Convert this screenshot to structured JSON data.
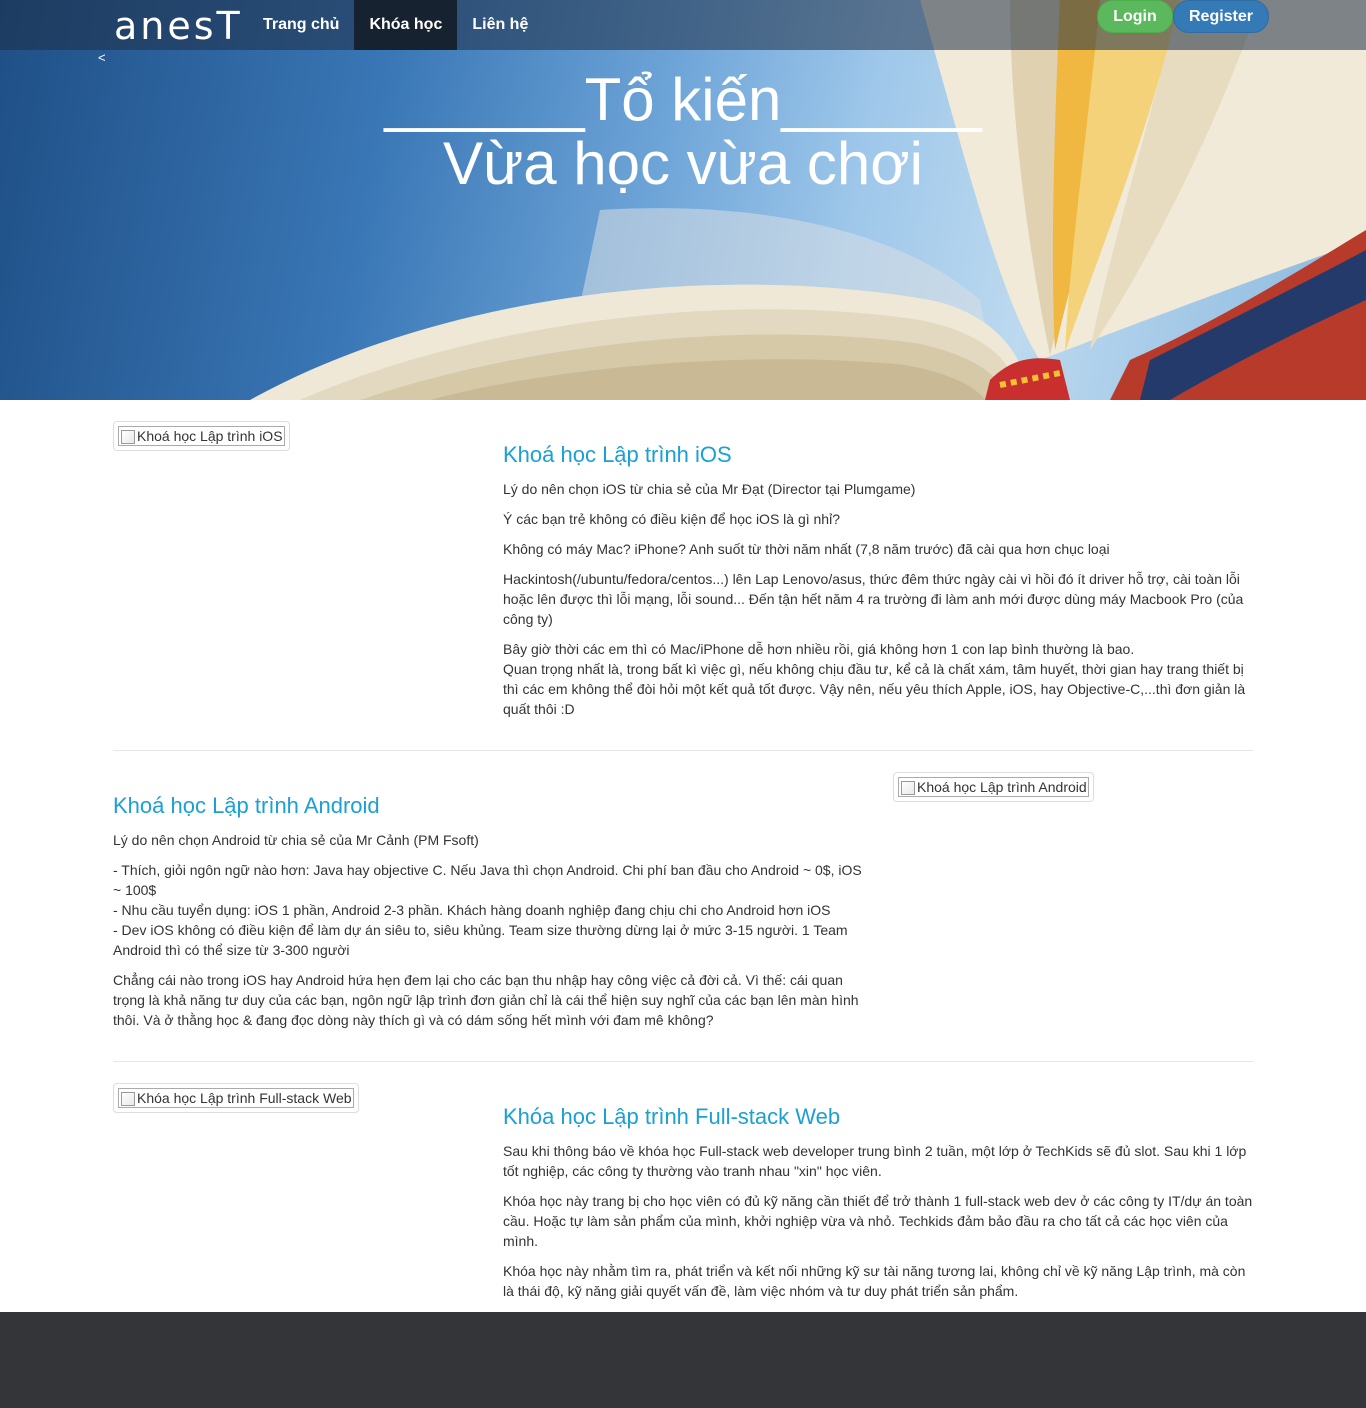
{
  "navbar": {
    "brand": "anesT",
    "items": [
      {
        "label": "Trang chủ"
      },
      {
        "label": "Khóa học"
      },
      {
        "label": "Liên hệ"
      }
    ],
    "login": "Login",
    "register": "Register"
  },
  "hero": {
    "prev": "<",
    "line1": "______Tổ kiến______",
    "line2": "Vừa học vừa chơi"
  },
  "courses": {
    "ios": {
      "image_alt": "Khoá học Lập trình iOS",
      "title": "Khoá học Lập trình iOS",
      "p1": "Lý do nên chọn iOS từ chia sẻ của Mr Đạt (Director tại Plumgame)",
      "p2": "Ý các bạn trẻ không có điều kiện để học iOS là gì nhỉ?",
      "p3": "Không có máy Mac? iPhone? Anh suốt từ thời năm nhất (7,8 năm trước) đã cài qua hơn chục loại",
      "p4": "Hackintosh(/ubuntu/fedora/centos...) lên Lap Lenovo/asus, thức đêm thức ngày cài vì hồi đó ít driver hỗ trợ, cài toàn lỗi hoặc lên được thì lỗi mạng, lỗi sound... Đến tận hết năm 4 ra trường đi làm anh mới được dùng máy Macbook Pro (của công ty)",
      "p5a": "Bây giờ thời các em thì có Mac/iPhone dễ hơn nhiều rồi, giá không hơn 1 con lap bình thường là bao.",
      "p5b": "Quan trọng nhất là, trong bất kì việc gì, nếu không chịu đầu tư, kể cả là chất xám, tâm huyết, thời gian hay trang thiết bị thì các em không thể đòi hỏi một kết quả tốt được. Vậy nên, nếu yêu thích Apple, iOS, hay Objective-C,...thì đơn giản là quất thôi :D"
    },
    "android": {
      "image_alt": "Khoá học Lập trình Android",
      "title": "Khoá học Lập trình Android",
      "p1": "Lý do nên chọn Android từ chia sẻ của Mr Cảnh (PM Fsoft)",
      "p2a": "- Thích, giỏi ngôn ngữ nào hơn: Java hay objective C. Nếu Java thì chọn Android. Chi phí ban đầu cho Android ~ 0$, iOS ~ 100$",
      "p2b": "- Nhu cầu tuyển dụng: iOS 1 phần, Android 2-3 phần. Khách hàng doanh nghiệp đang chịu chi cho Android hơn iOS",
      "p2c": "- Dev iOS không có điều kiện để làm dự án siêu to, siêu khủng. Team size thường dừng lại ở mức 3-15 người. 1 Team Android thì có thể size từ 3-300 người",
      "p3": "Chẳng cái nào trong iOS hay Android hứa hẹn đem lại cho các bạn thu nhập hay công việc cả đời cả. Vì thế: cái quan trọng là khả năng tư duy của các bạn, ngôn ngữ lập trình đơn giản chỉ là cái thể hiện suy nghĩ của các bạn lên màn hình thôi. Và ở thằng học & đang đọc dòng này thích gì và có dám sống hết mình với đam mê không?"
    },
    "web": {
      "image_alt": "Khóa học Lập trình Full-stack Web",
      "title": "Khóa học Lập trình Full-stack Web",
      "p1": "Sau khi thông báo về khóa học Full-stack web developer trung bình 2 tuần, một lớp ở TechKids sẽ đủ slot. Sau khi 1 lớp tốt nghiệp, các công ty thường vào tranh nhau \"xin\" học viên.",
      "p2": "Khóa học này trang bị cho học viên có đủ kỹ năng cần thiết để trở thành 1 full-stack web dev ở các công ty IT/dự án toàn cầu. Hoặc tự làm sản phẩm của mình, khởi nghiệp vừa và nhỏ. Techkids đảm bảo đầu ra cho tất cả các học viên của mình.",
      "p3": "Khóa học này nhằm tìm ra, phát triển và kết nối những kỹ sư tài năng tương lai, không chỉ về kỹ năng Lập trình, mà còn là thái độ, kỹ năng giải quyết vấn đề, làm việc nhóm và tư duy phát triển sản phẩm."
    }
  }
}
